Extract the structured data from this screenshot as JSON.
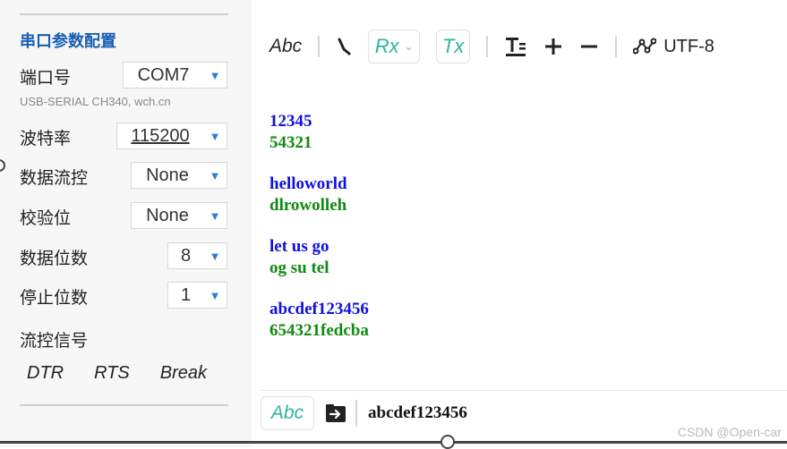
{
  "left_panel": {
    "section_title": "串口参数配置",
    "port": {
      "label": "端口号",
      "value": "COM7",
      "sub": "USB-SERIAL CH340, wch.cn"
    },
    "baud": {
      "label": "波特率",
      "value": "115200"
    },
    "flow": {
      "label": "数据流控",
      "value": "None"
    },
    "parity": {
      "label": "校验位",
      "value": "None"
    },
    "databits": {
      "label": "数据位数",
      "value": "8"
    },
    "stopbits": {
      "label": "停止位数",
      "value": "1"
    },
    "signals": {
      "label": "流控信号",
      "dtr": "DTR",
      "rts": "RTS",
      "brk": "Break"
    }
  },
  "toolbar": {
    "abc": "Abc",
    "rx": "Rx",
    "tx": "Tx",
    "encoding": "UTF-8"
  },
  "log": [
    {
      "tx": "12345",
      "rx": "54321"
    },
    {
      "tx": "helloworld",
      "rx": "dlrowolleh"
    },
    {
      "tx": "let us go",
      "rx": "og su tel"
    },
    {
      "tx": "abcdef123456",
      "rx": "654321fedcba"
    }
  ],
  "input": {
    "mode": "Abc",
    "value": "abcdef123456"
  },
  "watermark": "CSDN @Open-car",
  "colors": {
    "accent_blue": "#1a5fb4",
    "teal": "#2bb5a0",
    "tx_text": "#1010e0",
    "rx_text": "#108a10"
  }
}
